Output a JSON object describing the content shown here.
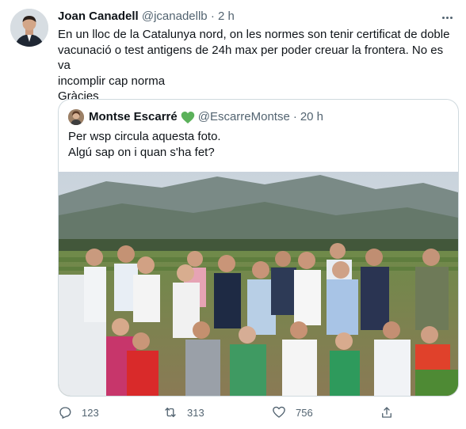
{
  "tweet": {
    "author_name": "Joan Canadell",
    "author_handle": "@jcanadellb",
    "separator": "·",
    "time": "2 h",
    "text_lines": [
      "En un lloc de la Catalunya nord, on les normes son tenir certificat de doble",
      "vacunació o test antigens de 24h max per poder creuar la frontera. No es va",
      "incomplir cap norma",
      "Gràcies"
    ]
  },
  "quote": {
    "author_name": "Montse Escarré",
    "author_handle": "@EscarreMontse",
    "separator": "·",
    "time": "20 h",
    "badge_icon": "green-heart-icon",
    "text_lines": [
      "Per wsp circula aquesta foto.",
      "Algú sap on i quan s'ha fet?"
    ]
  },
  "actions": {
    "reply_count": "123",
    "retweet_count": "313",
    "like_count": "756"
  },
  "colors": {
    "text": "#0f1419",
    "muted": "#536471",
    "border": "#cfd9de",
    "heart_badge": "#5bb15a"
  }
}
